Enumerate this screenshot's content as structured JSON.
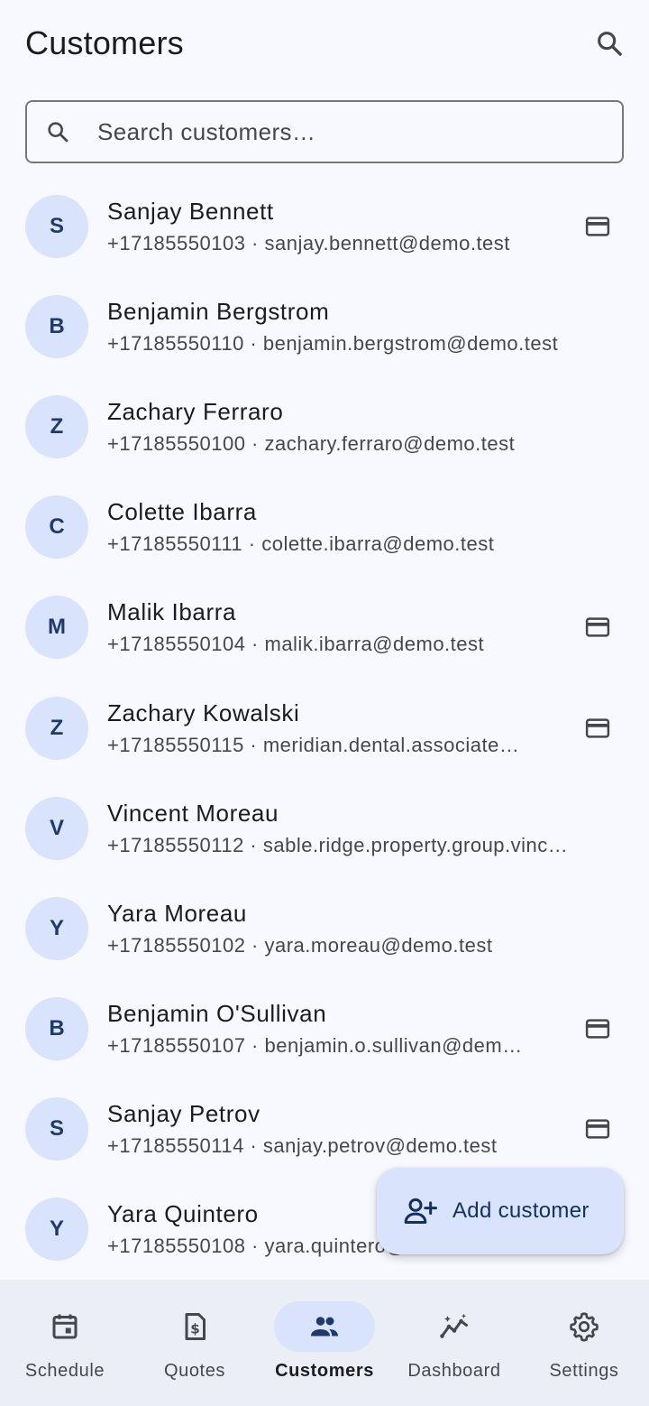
{
  "header": {
    "title": "Customers",
    "search_icon": "search-icon"
  },
  "search": {
    "placeholder": "Search customers…",
    "value": ""
  },
  "customers": [
    {
      "initial": "S",
      "name": "Sanjay Bennett",
      "sub": "+17185550103 · sanjay.bennett@demo.test",
      "card": true
    },
    {
      "initial": "B",
      "name": "Benjamin Bergstrom",
      "sub": "+17185550110 · benjamin.bergstrom@demo.test",
      "card": false
    },
    {
      "initial": "Z",
      "name": "Zachary Ferraro",
      "sub": "+17185550100 · zachary.ferraro@demo.test",
      "card": false
    },
    {
      "initial": "C",
      "name": "Colette Ibarra",
      "sub": "+17185550111 · colette.ibarra@demo.test",
      "card": false
    },
    {
      "initial": "M",
      "name": "Malik Ibarra",
      "sub": "+17185550104 · malik.ibarra@demo.test",
      "card": true
    },
    {
      "initial": "Z",
      "name": "Zachary Kowalski",
      "sub": "+17185550115 · meridian.dental.associate…",
      "card": true
    },
    {
      "initial": "V",
      "name": "Vincent Moreau",
      "sub": "+17185550112 · sable.ridge.property.group.vinc…",
      "card": false
    },
    {
      "initial": "Y",
      "name": "Yara Moreau",
      "sub": "+17185550102 · yara.moreau@demo.test",
      "card": false
    },
    {
      "initial": "B",
      "name": "Benjamin O'Sullivan",
      "sub": "+17185550107 · benjamin.o.sullivan@dem…",
      "card": true
    },
    {
      "initial": "S",
      "name": "Sanjay Petrov",
      "sub": "+17185550114 · sanjay.petrov@demo.test",
      "card": true
    },
    {
      "initial": "Y",
      "name": "Yara Quintero",
      "sub": "+17185550108 · yara.quintero@demo.test",
      "card": false
    }
  ],
  "fab": {
    "label": "Add customer",
    "icon": "person-add-icon"
  },
  "nav": {
    "items": [
      {
        "label": "Schedule",
        "icon": "calendar-icon",
        "active": false
      },
      {
        "label": "Quotes",
        "icon": "receipt-dollar-icon",
        "active": false
      },
      {
        "label": "Customers",
        "icon": "people-icon",
        "active": true
      },
      {
        "label": "Dashboard",
        "icon": "insights-icon",
        "active": false
      },
      {
        "label": "Settings",
        "icon": "gear-icon",
        "active": false
      }
    ]
  },
  "colors": {
    "background": "#f8f9ff",
    "avatar_bg": "#d9e3fb",
    "accent_text": "#14305e",
    "nav_bg": "#eceef6"
  }
}
